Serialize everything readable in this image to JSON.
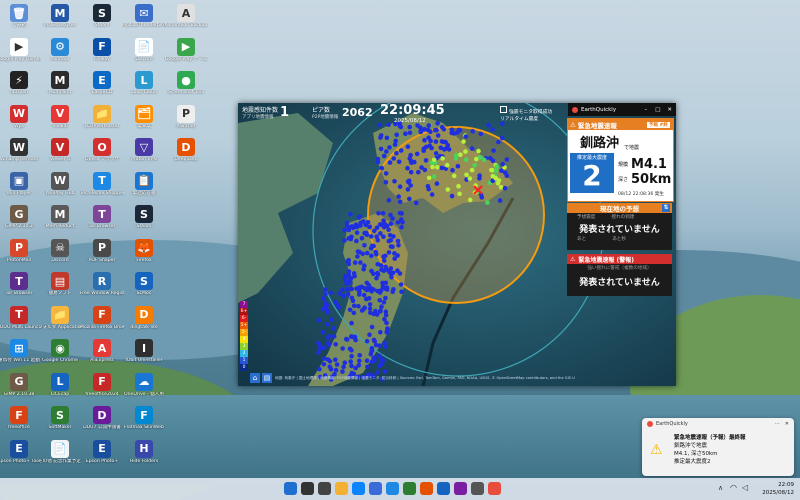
{
  "desktop": {
    "icons": [
      {
        "label": "ごみ箱",
        "color": "#5c8fd6",
        "glyph": "🗑",
        "col": 0,
        "row": 0
      },
      {
        "label": "Malwarebytes",
        "color": "#2458a6",
        "glyph": "M",
        "col": 1,
        "row": 0
      },
      {
        "label": "Steam",
        "color": "#1b2838",
        "glyph": "S",
        "col": 2,
        "row": 0
      },
      {
        "label": "MozillaThunderbird",
        "color": "#3b6ec9",
        "glyph": "✉",
        "col": 3,
        "row": 0
      },
      {
        "label": "Ashampoo Backup",
        "color": "#e0e0e0",
        "glyph": "A",
        "col": 4,
        "row": 0
      },
      {
        "label": "Google Play Games",
        "color": "#ffffff",
        "glyph": "▶",
        "col": 0,
        "row": 1
      },
      {
        "label": "Minitool",
        "color": "#2b8ad8",
        "glyph": "⚙",
        "col": 1,
        "row": 1
      },
      {
        "label": "Finway",
        "color": "#0a4fa8",
        "glyph": "F",
        "col": 2,
        "row": 1
      },
      {
        "label": "Discord",
        "color": "#ffffff",
        "glyph": "📄",
        "col": 3,
        "row": 1
      },
      {
        "label": "Google Play ゲーム",
        "color": "#3aa64b",
        "glyph": "▶",
        "col": 4,
        "row": 1
      },
      {
        "label": "nbOpen",
        "color": "#222",
        "glyph": "⚡",
        "col": 0,
        "row": 2
      },
      {
        "label": "MultiPaint",
        "color": "#2c2c2c",
        "glyph": "M",
        "col": 1,
        "row": 2
      },
      {
        "label": "EasyBCD",
        "color": "#0b69c7",
        "glyph": "E",
        "col": 2,
        "row": 2
      },
      {
        "label": "Loop Cloud",
        "color": "#2a9ad0",
        "glyph": "L",
        "col": 3,
        "row": 2
      },
      {
        "label": "Screenshot Tool",
        "color": "#2faa52",
        "glyph": "●",
        "col": 4,
        "row": 2
      },
      {
        "label": "Wps",
        "color": "#d32f2f",
        "glyph": "W",
        "col": 0,
        "row": 3
      },
      {
        "label": "Vivaldi",
        "color": "#e53935",
        "glyph": "V",
        "col": 1,
        "row": 3
      },
      {
        "label": "LCRPVerMaster",
        "color": "#f2b134",
        "glyph": "📁",
        "col": 2,
        "row": 3
      },
      {
        "label": "電卓案",
        "color": "#ff8f00",
        "glyph": "🗂",
        "col": 3,
        "row": 3
      },
      {
        "label": "Paintnet",
        "color": "#eeeeee",
        "glyph": "P",
        "col": 4,
        "row": 3
      },
      {
        "label": "Winamp Remote",
        "color": "#333",
        "glyph": "W",
        "col": 0,
        "row": 4
      },
      {
        "label": "Viewer 6",
        "color": "#c62828",
        "glyph": "V",
        "col": 1,
        "row": 4
      },
      {
        "label": "Opera ブラウザ",
        "color": "#d32f2f",
        "glyph": "O",
        "col": 2,
        "row": 4
      },
      {
        "label": "Proton VPN",
        "color": "#4a3aa6",
        "glyph": "▽",
        "col": 3,
        "row": 4
      },
      {
        "label": "DeepSkep",
        "color": "#e65100",
        "glyph": "D",
        "col": 4,
        "row": 4
      },
      {
        "label": "Win Player",
        "color": "#3a63a8",
        "glyph": "▣",
        "col": 0,
        "row": 5
      },
      {
        "label": "WinPlay Hub",
        "color": "#555",
        "glyph": "W",
        "col": 1,
        "row": 5
      },
      {
        "label": "TechRecov Shopper",
        "color": "#1e88e5",
        "glyph": "T",
        "col": 2,
        "row": 5
      },
      {
        "label": "電話応答書",
        "color": "#1976d2",
        "glyph": "📋",
        "col": 3,
        "row": 5
      },
      {
        "label": "GIMP 2.10.2",
        "color": "#6d5a47",
        "glyph": "G",
        "col": 0,
        "row": 6
      },
      {
        "label": "Mem Reduct",
        "color": "#5a5a5a",
        "glyph": "M",
        "col": 1,
        "row": 6
      },
      {
        "label": "Tor Browser",
        "color": "#7d4698",
        "glyph": "T",
        "col": 2,
        "row": 6
      },
      {
        "label": "Steam",
        "color": "#1b2838",
        "glyph": "S",
        "col": 3,
        "row": 6
      },
      {
        "label": "ProtonMail",
        "color": "#d9472b",
        "glyph": "P",
        "col": 0,
        "row": 7
      },
      {
        "label": "Discord",
        "color": "#555",
        "glyph": "☠",
        "col": 1,
        "row": 7
      },
      {
        "label": "PDF Shaper",
        "color": "#4a4a4a",
        "glyph": "P",
        "col": 2,
        "row": 7
      },
      {
        "label": "Firefox",
        "color": "#e65100",
        "glyph": "🦊",
        "col": 3,
        "row": 7
      },
      {
        "label": "Tor Browser",
        "color": "#5c2f8f",
        "glyph": "T",
        "col": 0,
        "row": 8
      },
      {
        "label": "簡易ソフト",
        "color": "#c0392b",
        "glyph": "▤",
        "col": 1,
        "row": 8
      },
      {
        "label": "Free Window Registry Repair",
        "color": "#2a6fb0",
        "glyph": "R",
        "col": 2,
        "row": 8
      },
      {
        "label": "ScMoc",
        "color": "#1565c0",
        "glyph": "S",
        "col": 3,
        "row": 8
      },
      {
        "label": "TODO Multi Launcher",
        "color": "#c62828",
        "glyph": "T",
        "col": 0,
        "row": 9
      },
      {
        "label": "フォルダ Application",
        "color": "#f6b73c",
        "glyph": "📁",
        "col": 1,
        "row": 9
      },
      {
        "label": "Mozilla Firefox Browser",
        "color": "#d84315",
        "glyph": "F",
        "col": 2,
        "row": 9
      },
      {
        "label": "dingtalk-lite",
        "color": "#f57c00",
        "glyph": "D",
        "col": 3,
        "row": 9
      },
      {
        "label": "重ね付 Win 11 起動",
        "color": "#1e88e5",
        "glyph": "⊞",
        "col": 0,
        "row": 10
      },
      {
        "label": "Google Chrome",
        "color": "#2e7d32",
        "glyph": "◉",
        "col": 1,
        "row": 10
      },
      {
        "label": "AliExpress",
        "color": "#e53935",
        "glyph": "A",
        "col": 2,
        "row": 10
      },
      {
        "label": "IObit Uninstaller",
        "color": "#2f2f2f",
        "glyph": "I",
        "col": 3,
        "row": 10
      },
      {
        "label": "GIMP 2.10.38",
        "color": "#6d5a47",
        "glyph": "G",
        "col": 0,
        "row": 11
      },
      {
        "label": "LICEcap",
        "color": "#1565c0",
        "glyph": "L",
        "col": 1,
        "row": 11
      },
      {
        "label": "freeoffice2024",
        "color": "#c62828",
        "glyph": "F",
        "col": 2,
        "row": 11
      },
      {
        "label": "OneDrive - 個人用",
        "color": "#1976d2",
        "glyph": "☁",
        "col": 3,
        "row": 11
      },
      {
        "label": "freeoffice",
        "color": "#d84315",
        "glyph": "F",
        "col": 0,
        "row": 12
      },
      {
        "label": "SoftMaker",
        "color": "#2e7d32",
        "glyph": "S",
        "col": 1,
        "row": 12
      },
      {
        "label": "DDU7 公開申請書",
        "color": "#6a1b9a",
        "glyph": "D",
        "col": 2,
        "row": 12
      },
      {
        "label": "Flatmax SkinWeb",
        "color": "#0288d1",
        "glyph": "F",
        "col": 3,
        "row": 12
      },
      {
        "label": "Epson Photo+ Tool",
        "color": "#1a4fa0",
        "glyph": "E",
        "col": 0,
        "row": 13
      },
      {
        "label": "その他 記念作業予定.txt",
        "color": "#f5f5f5",
        "glyph": "📄",
        "col": 1,
        "row": 13
      },
      {
        "label": "Epson Photo+",
        "color": "#1a4fa0",
        "glyph": "E",
        "col": 2,
        "row": 13
      },
      {
        "label": "Hide Folders",
        "color": "#3949ab",
        "glyph": "H",
        "col": 3,
        "row": 13
      }
    ]
  },
  "eq": {
    "window_title": "EarthQuickly",
    "header": {
      "quake_count_label": "地震感知件数",
      "quake_count_sub": "アプリ地震情報",
      "quake_count_value": "1",
      "peer_label": "ピア数",
      "peer_sub": "P2P地震情報",
      "peer_value": "2062",
      "time_value": "22:09:45",
      "date_value": "2025/08/12",
      "monitor_check_label": "強震モニタ取得成功",
      "monitor_sub": "リアルタイム震度"
    },
    "eew": {
      "banner": "緊急地震速報",
      "badge": "予報 #終",
      "region": "釧路沖",
      "region_suffix": "で地震",
      "intensity_label": "推定最大震度",
      "intensity_value": "2",
      "magnitude_label": "規模",
      "magnitude_value": "M4.1",
      "depth_label": "深さ",
      "depth_value": "50km",
      "issued": "08/12 22:08:36 発生"
    },
    "local": {
      "title": "現在地の予想",
      "sub_left": "予想震度",
      "sub_right": "揺れの到達",
      "sub2_left": "あと",
      "sub2_right": "あと秒",
      "status": "発表されていません"
    },
    "warning": {
      "title": "緊急地震速報 (警報)",
      "sub": "強い揺れに警戒（複数の地域）",
      "status": "発表されていません"
    },
    "scale_values": [
      "7",
      "6+",
      "6-",
      "5+",
      "5-",
      "4",
      "3",
      "2",
      "1",
      "0"
    ],
    "scale_colors": [
      "#8b0f8f",
      "#b01212",
      "#e41a1a",
      "#f05a00",
      "#f5a300",
      "#f5e000",
      "#8bd12a",
      "#2fb7e8",
      "#2456d6",
      "#0a2a8a"
    ],
    "attribution": "地図: 気象庁 | 国土地理院 | 地震情報: P2P地震情報 | 強震モニタ: 防災科研 | Sources: Esri, TomTom, Garmin, FAO, NOAA, USGS, © OpenStreetMap contributors, and the GIS User Community"
  },
  "taskbar": {
    "time": "22:09",
    "date": "2025/08/12",
    "icons": [
      "start",
      "search",
      "taskview",
      "explorer",
      "edge",
      "store",
      "mail",
      "chrome",
      "firefox",
      "thunderbird",
      "photos",
      "settings",
      "earthquickly"
    ]
  },
  "toast": {
    "app": "EarthQuickly",
    "title": "緊急地震速報（予報）最終報",
    "line1": "釧路沖で地震",
    "line2": "M4.1, 深さ50km",
    "line3": "推定最大震度2"
  }
}
